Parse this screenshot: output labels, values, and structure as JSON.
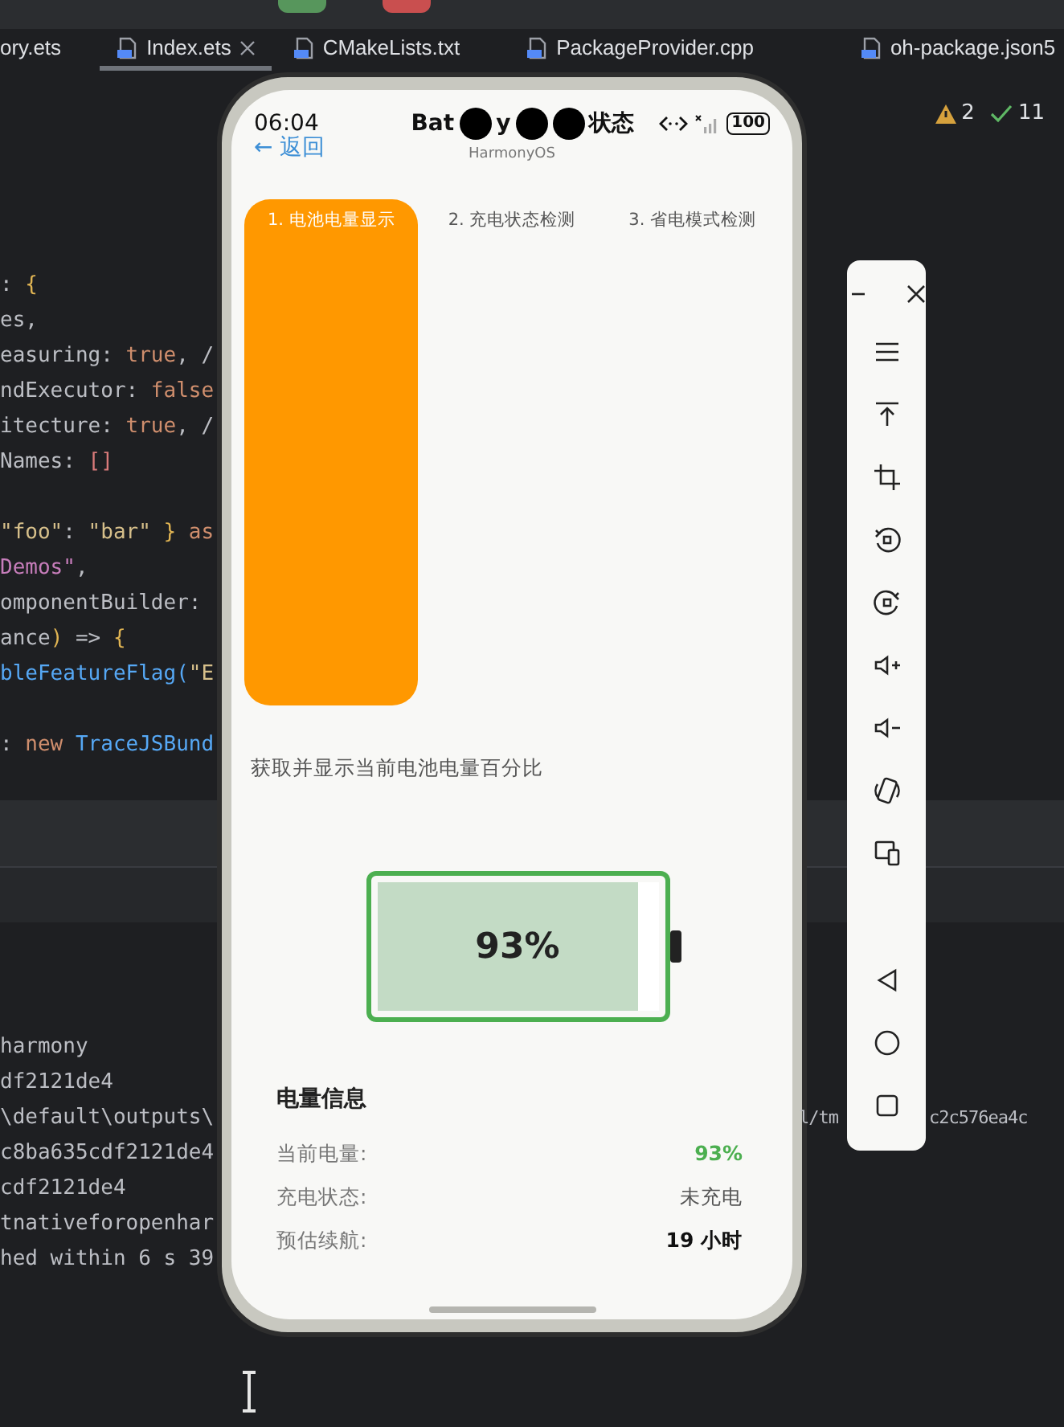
{
  "ide": {
    "tabs": [
      {
        "label": "ory.ets",
        "selected": false
      },
      {
        "label": "Index.ets",
        "selected": true
      },
      {
        "label": "CMakeLists.txt",
        "selected": false
      },
      {
        "label": "PackageProvider.cpp",
        "selected": false
      },
      {
        "label": "oh-package.json5",
        "selected": false
      }
    ],
    "warnings": "2",
    "checks": "11",
    "code_lines": [
      {
        "tokens": [
          {
            "text": ":",
            "kind": "plain"
          },
          {
            "text": " {",
            "kind": "brace"
          }
        ]
      },
      {
        "tokens": [
          {
            "text": "es,",
            "kind": "plain"
          }
        ]
      },
      {
        "tokens": [
          {
            "text": "easuring: ",
            "kind": "plain"
          },
          {
            "text": "true",
            "kind": "keyword"
          },
          {
            "text": ", /",
            "kind": "plain"
          }
        ]
      },
      {
        "tokens": [
          {
            "text": "ndExecutor: ",
            "kind": "plain"
          },
          {
            "text": "false",
            "kind": "keyword"
          }
        ]
      },
      {
        "tokens": [
          {
            "text": "itecture: ",
            "kind": "plain"
          },
          {
            "text": "true",
            "kind": "keyword"
          },
          {
            "text": ", /",
            "kind": "plain"
          }
        ]
      },
      {
        "tokens": [
          {
            "text": "Names: ",
            "kind": "plain"
          },
          {
            "text": "[]",
            "kind": "bracket"
          }
        ]
      },
      {
        "blank_before": true,
        "tokens": [
          {
            "text": "\"foo\"",
            "kind": "string"
          },
          {
            "text": ": ",
            "kind": "plain"
          },
          {
            "text": "\"bar\"",
            "kind": "string"
          },
          {
            "text": " } ",
            "kind": "brace"
          },
          {
            "text": "as",
            "kind": "keyword"
          }
        ]
      },
      {
        "tokens": [
          {
            "text": "Demos\"",
            "kind": "purple"
          },
          {
            "text": ",",
            "kind": "plain"
          }
        ]
      },
      {
        "tokens": [
          {
            "text": "omponentBuilder:",
            "kind": "plain"
          }
        ]
      },
      {
        "tokens": [
          {
            "text": "ance",
            "kind": "plain"
          },
          {
            "text": ")",
            "kind": "brace"
          },
          {
            "text": " => ",
            "kind": "plain"
          },
          {
            "text": "{",
            "kind": "brace"
          }
        ]
      },
      {
        "tokens": [
          {
            "text": "bleFeatureFlag(",
            "kind": "call"
          },
          {
            "text": "\"E",
            "kind": "string"
          }
        ]
      },
      {
        "blank_before": true,
        "tokens": [
          {
            "text": ": ",
            "kind": "plain"
          },
          {
            "text": "new ",
            "kind": "keyword"
          },
          {
            "text": "TraceJSBund",
            "kind": "call"
          }
        ]
      }
    ],
    "console_lines": [
      {
        "text": "harmony"
      },
      {
        "text": "df2121de4"
      },
      {
        "text": "\\default\\outputs\\",
        "fragments": [
          "l/tm",
          "c2c576ea4c"
        ]
      },
      {
        "text": "c8ba635cdf2121de4"
      },
      {
        "text": "cdf2121de4"
      },
      {
        "text": "tnativeforopenhar"
      },
      {
        "text": "hed within 6 s 39"
      }
    ]
  },
  "phone": {
    "time": "06:04",
    "title_parts": [
      "Bat",
      "y",
      "状态"
    ],
    "subtitle": "HarmonyOS",
    "back": "← 返回",
    "battery_status": "100",
    "tabs": [
      {
        "label": "1. 电池电量显示",
        "selected": true
      },
      {
        "label": "2. 充电状态检测",
        "selected": false
      },
      {
        "label": "3. 省电模式检测",
        "selected": false
      }
    ],
    "description": "获取并显示当前电池电量百分比",
    "battery": {
      "level": 0.93,
      "reading": "93%"
    },
    "info": {
      "title": "电量信息",
      "rows": [
        {
          "label": "当前电量:",
          "value": "93%",
          "kind": "highlight"
        },
        {
          "label": "充电状态:",
          "value": "未充电",
          "kind": "muted"
        },
        {
          "label": "预估续航:",
          "value": "19 小时",
          "kind": "strong"
        }
      ]
    }
  }
}
